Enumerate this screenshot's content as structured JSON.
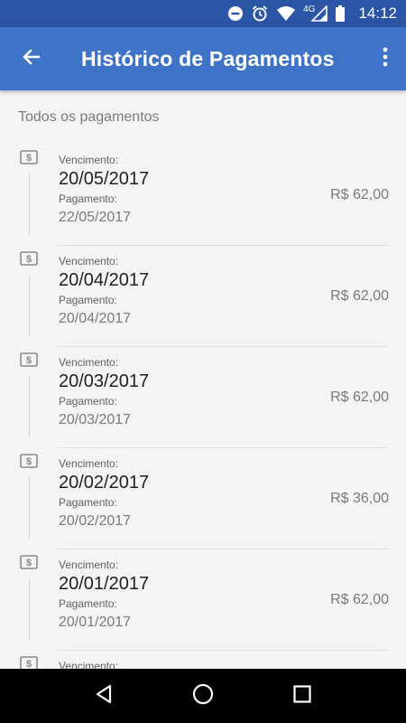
{
  "status_bar": {
    "time": "14:12",
    "network": "4G"
  },
  "app_bar": {
    "title": "Histórico de Pagamentos"
  },
  "section": {
    "header": "Todos os pagamentos"
  },
  "payments": [
    {
      "due_label": "Vencimento:",
      "due_date": "20/05/2017",
      "paid_label": "Pagamento:",
      "paid_date": "22/05/2017",
      "amount": "R$ 62,00"
    },
    {
      "due_label": "Vencimento:",
      "due_date": "20/04/2017",
      "paid_label": "Pagamento:",
      "paid_date": "20/04/2017",
      "amount": "R$ 62,00"
    },
    {
      "due_label": "Vencimento:",
      "due_date": "20/03/2017",
      "paid_label": "Pagamento:",
      "paid_date": "20/03/2017",
      "amount": "R$ 62,00"
    },
    {
      "due_label": "Vencimento:",
      "due_date": "20/02/2017",
      "paid_label": "Pagamento:",
      "paid_date": "20/02/2017",
      "amount": "R$ 36,00"
    },
    {
      "due_label": "Vencimento:",
      "due_date": "20/01/2017",
      "paid_label": "Pagamento:",
      "paid_date": "20/01/2017",
      "amount": "R$ 62,00"
    },
    {
      "due_label": "Vencimento:"
    }
  ],
  "icons": {
    "back": "arrow-back-icon",
    "more": "more-vert-icon",
    "payment": "money-icon",
    "nav_back": "triangle-back-icon",
    "nav_home": "circle-home-icon",
    "nav_recents": "square-recents-icon"
  },
  "colors": {
    "status_bar": "#2b56a6",
    "app_bar": "#3f73c8",
    "background": "#f4f4f4",
    "nav_bar": "#000000"
  }
}
